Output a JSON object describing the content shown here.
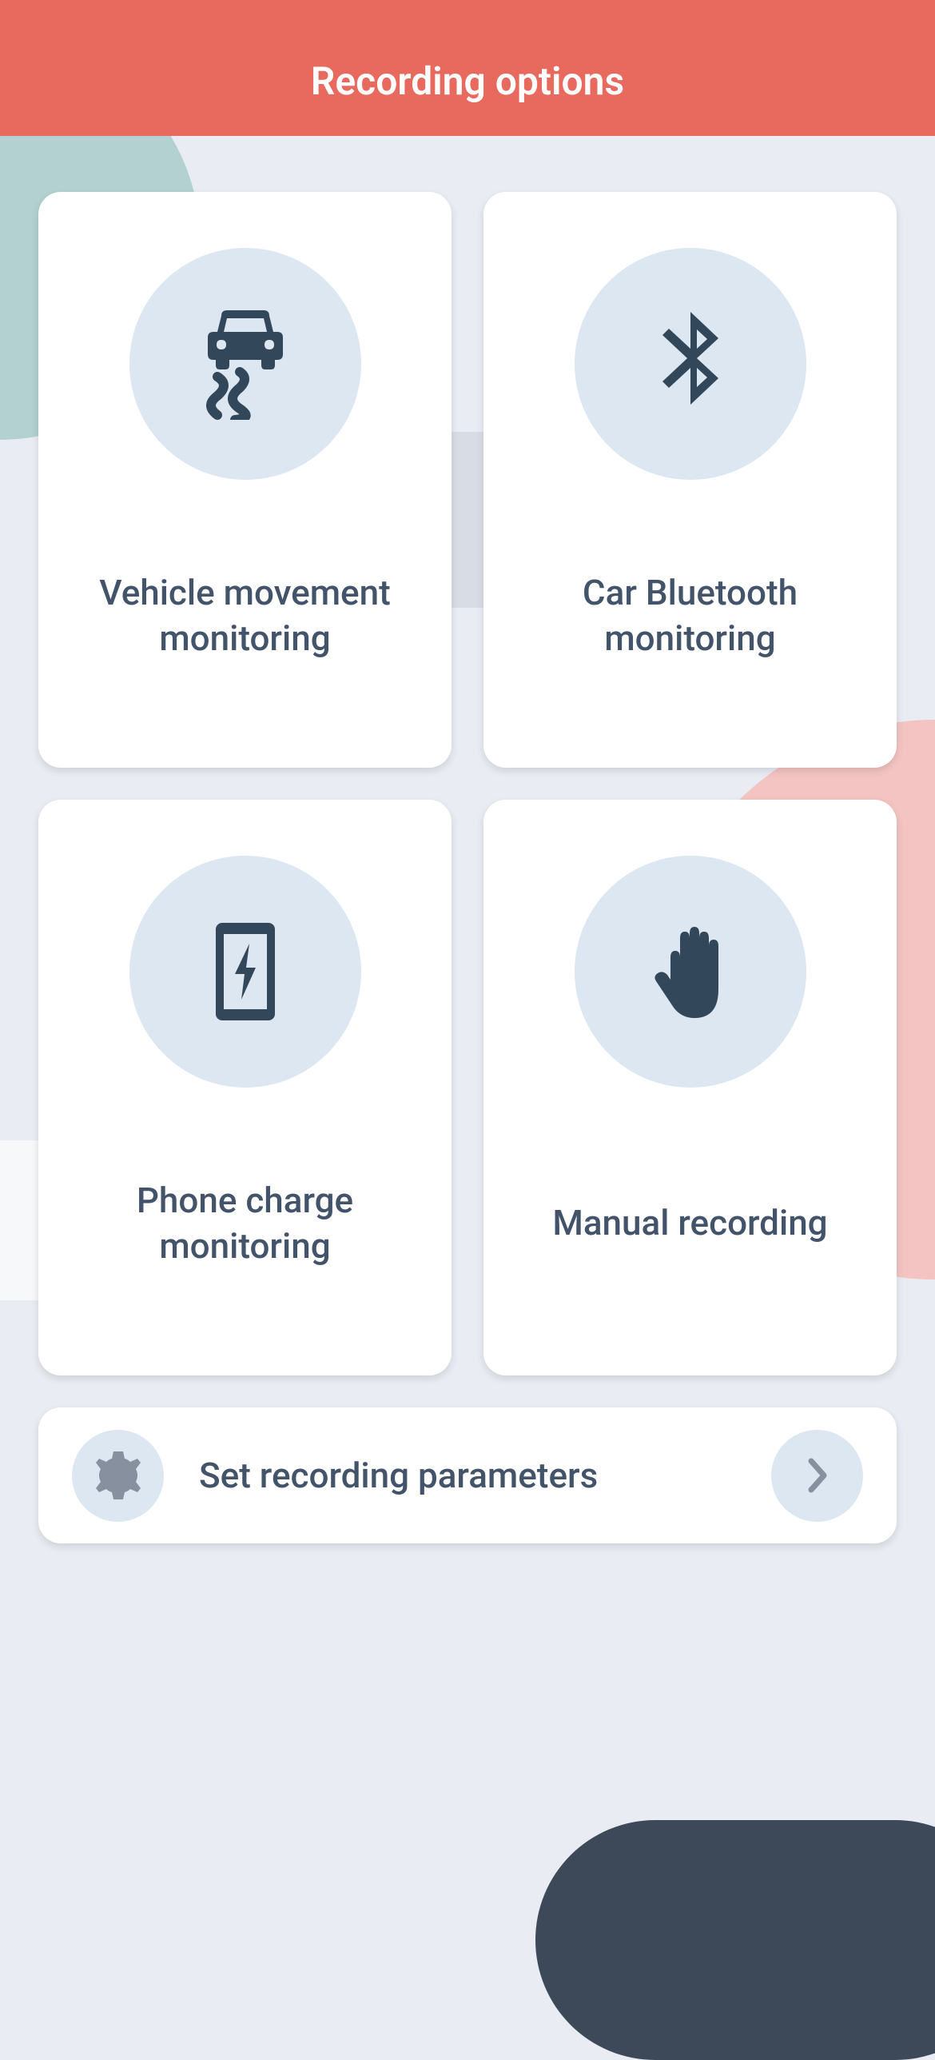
{
  "header": {
    "title": "Recording options"
  },
  "cards": [
    {
      "label": "Vehicle movement monitoring",
      "icon": "car-skid-icon"
    },
    {
      "label": "Car Bluetooth monitoring",
      "icon": "bluetooth-icon"
    },
    {
      "label": "Phone charge monitoring",
      "icon": "phone-charge-icon"
    },
    {
      "label": "Manual recording",
      "icon": "hand-icon"
    }
  ],
  "settings": {
    "label": "Set recording parameters",
    "icon": "gear-icon",
    "navIcon": "chevron-right-icon"
  },
  "colors": {
    "headerBg": "#e86a5e",
    "iconCircleBg": "#dde7f1",
    "text": "#42536a",
    "iconFill": "#33475b"
  }
}
